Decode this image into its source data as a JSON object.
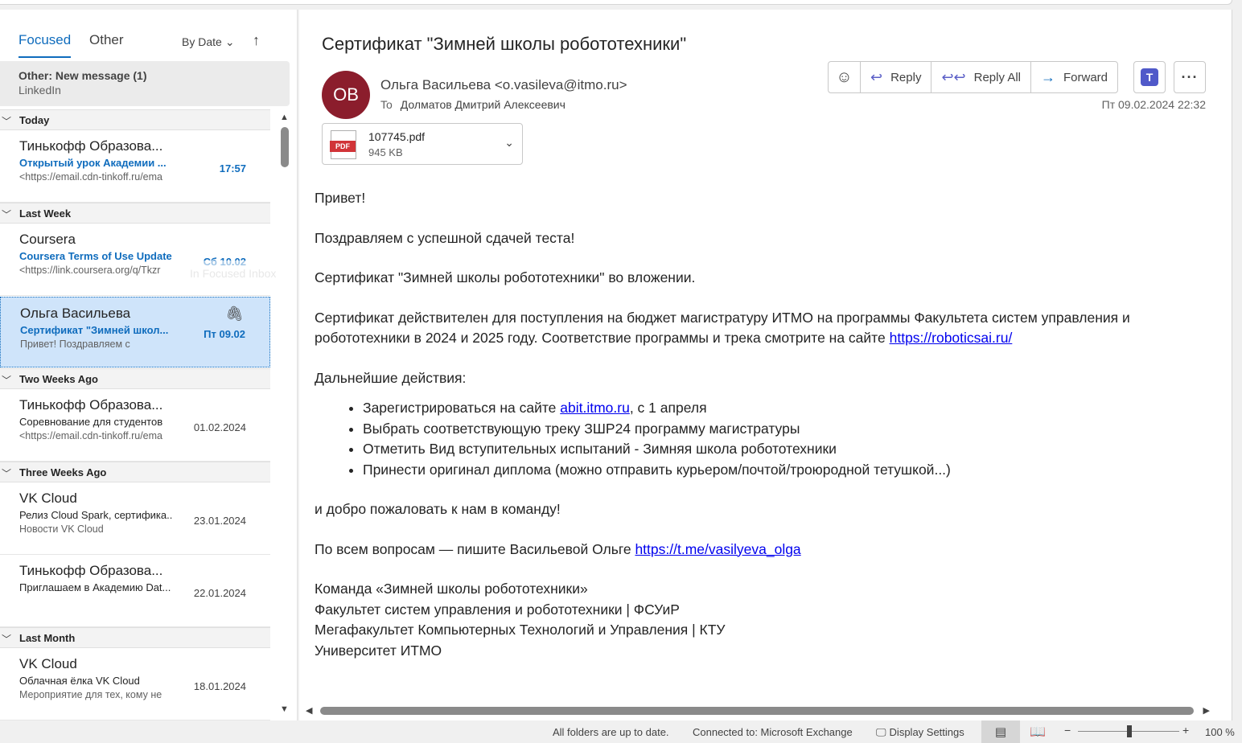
{
  "tabs": {
    "focused": "Focused",
    "other": "Other",
    "sort": "By Date",
    "sort_arrow": "↑"
  },
  "other_banner": {
    "title": "Other: New message (1)",
    "subtitle": "LinkedIn"
  },
  "groups": [
    "Today",
    "Last Week",
    "Two Weeks Ago",
    "Three Weeks Ago",
    "Last Month"
  ],
  "ghost_text": "In Focused Inbox",
  "messages": [
    {
      "sender": "Тинькофф Образова...",
      "subject": "Открытый урок Академии ...",
      "preview": "<https://email.cdn-tinkoff.ru/ema",
      "date": "17:57"
    },
    {
      "sender": "Coursera",
      "subject": "Coursera Terms of Use Update",
      "preview": "<https://link.coursera.org/q/Tkzr",
      "date": "Сб 10.02"
    },
    {
      "sender": "Ольга Васильева",
      "subject": "Сертификат \"Зимней школ...",
      "preview": "Привет!   Поздравляем с",
      "date": "Пт 09.02"
    },
    {
      "sender": "Тинькофф Образова...",
      "subject": "Соревнование для студентов",
      "preview": "<https://email.cdn-tinkoff.ru/ema",
      "date": "01.02.2024"
    },
    {
      "sender": "VK Cloud",
      "subject": "Релиз Cloud Spark, сертифика...",
      "preview": "Новости VK Cloud",
      "date": "23.01.2024"
    },
    {
      "sender": "Тинькофф Образова...",
      "subject": "Приглашаем в Академию Dat...",
      "preview": "",
      "date": "22.01.2024"
    },
    {
      "sender": "VK Cloud",
      "subject": "Облачная ёлка VK Cloud",
      "preview": "Мероприятие для тех, кому не",
      "date": "18.01.2024"
    }
  ],
  "mail": {
    "subject": "Сертификат \"Зимней школы робототехники\"",
    "avatar": "OB",
    "from": "Ольга Васильева <o.vasileva@itmo.ru>",
    "to_label": "To",
    "to": "Долматов Дмитрий Алексеевич",
    "date": "Пт 09.02.2024 22:32",
    "actions": {
      "reply": "Reply",
      "reply_all": "Reply All",
      "forward": "Forward"
    },
    "attachment": {
      "name": "107745.pdf",
      "size": "945 KB",
      "badge": "PDF"
    },
    "body": {
      "greeting": "Привет!",
      "congrats": "Поздравляем с успешной сдачей теста!",
      "cert": "Сертификат \"Зимней школы робототехники\" во вложении.",
      "valid_text": "Сертификат действителен для поступления на бюджет магистратуру ИТМО на программы Факультета систем управления и робототехники в 2024 и 2025 году. Соответствие программы и трека смотрите на сайте ",
      "valid_link": "https://roboticsai.ru/",
      "next_steps": "Дальнейшие действия:",
      "step1_prefix": "Зарегистрироваться на сайте ",
      "step1_link": "abit.itmo.ru",
      "step1_suffix": ", с 1 апреля",
      "step2": "Выбрать соответствующую треку ЗШР24 программу магистратуры",
      "step3": "Отметить Вид вступительных испытаний - Зимняя школа робототехники",
      "step4": "Принести оригинал диплома (можно отправить курьером/почтой/троюродной тетушкой...)",
      "welcome": "и добро пожаловать к нам в команду!",
      "questions_text": "По всем вопросам — пишите Васильевой Ольге ",
      "questions_link": "https://t.me/vasilyeva_olga",
      "sig1": "Команда «Зимней школы робототехники»",
      "sig2": "Факультет систем управления и робототехники | ФСУиР",
      "sig3": "Мегафакультет Компьютерных Технологий и Управления | КТУ",
      "sig4": "Университет ИТМО"
    }
  },
  "status": {
    "folders": "All folders are up to date.",
    "connection": "Connected to: Microsoft Exchange",
    "display_settings": "Display Settings",
    "zoom": "100 %",
    "zoom_level": 0.5
  },
  "colors": {
    "accent": "#0f6cbd",
    "avatar": "#8b1d2c",
    "selected": "#cfe4fa",
    "pdf": "#d13438",
    "teams": "#5059c9"
  }
}
